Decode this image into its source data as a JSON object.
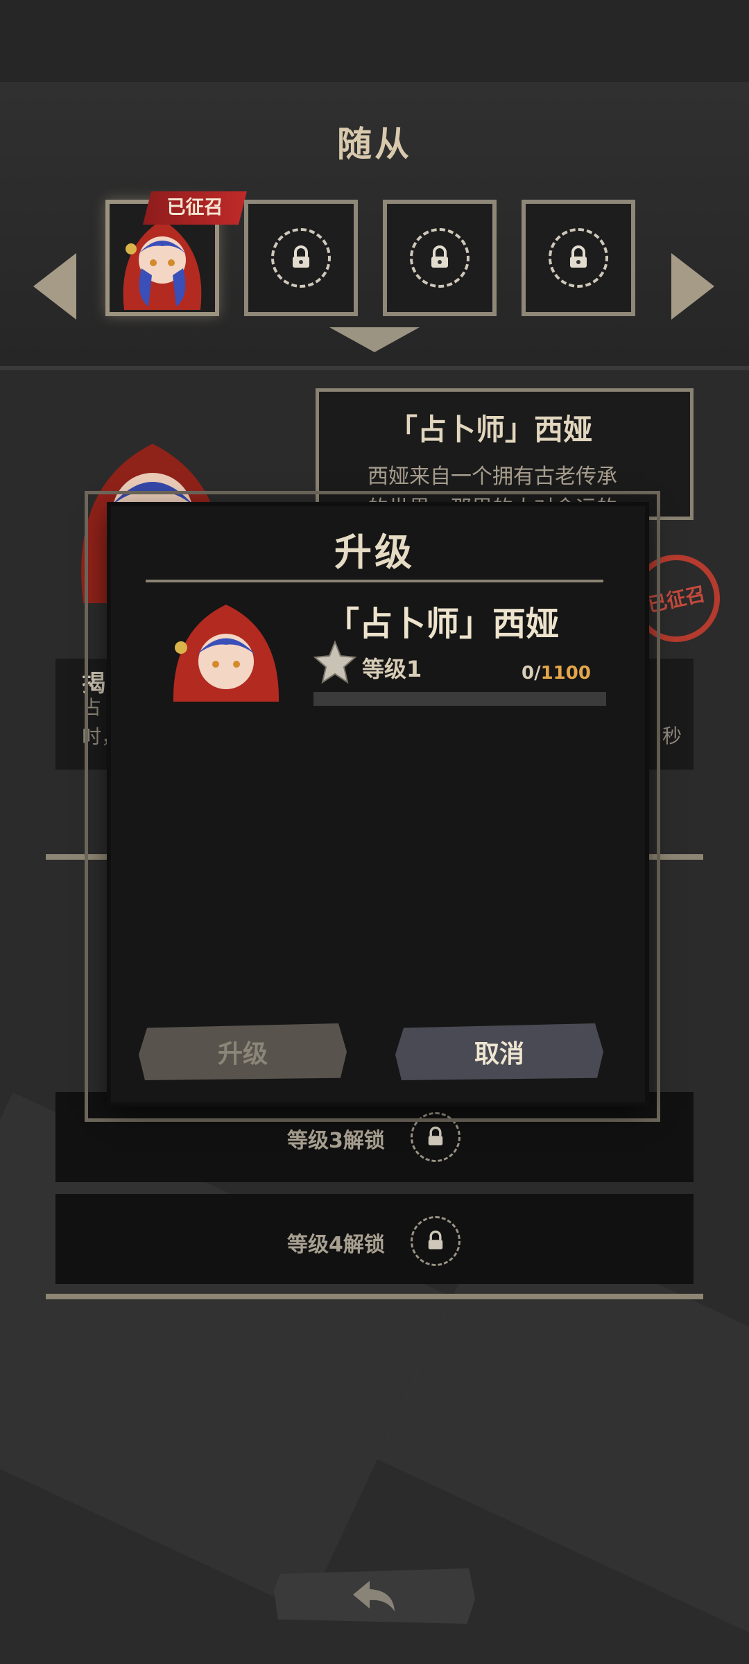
{
  "panel": {
    "title": "随从"
  },
  "slots": [
    {
      "name": "占卜师 西娅",
      "state": "selected",
      "badge": "已征召"
    },
    {
      "name": "locked-fox",
      "state": "locked"
    },
    {
      "name": "locked-chest",
      "state": "locked"
    },
    {
      "name": "locked-creature",
      "state": "locked"
    }
  ],
  "bio": {
    "title": "「占卜师」西娅",
    "text_line1": "西娅来自一个拥有古老传承",
    "text_line2": "的世界，那里的人对命运的"
  },
  "stamp": {
    "label": "已征召"
  },
  "skill": {
    "label": "揭",
    "line1": "占卜",
    "line2": "时，",
    "side": "秒"
  },
  "tiers": [
    {
      "label": "等级3解锁"
    },
    {
      "label": "等级4解锁"
    }
  ],
  "modal": {
    "title": "升级",
    "hero_name": "「占卜师」西娅",
    "level": "等级1",
    "xp_current": "0/",
    "xp_max": "1100",
    "xp_fraction": 0,
    "upgrade_label": "升级",
    "cancel_label": "取消"
  },
  "colors": {
    "accent": "#c99a45",
    "badge_red": "#c02a2a",
    "panel": "#161616"
  }
}
